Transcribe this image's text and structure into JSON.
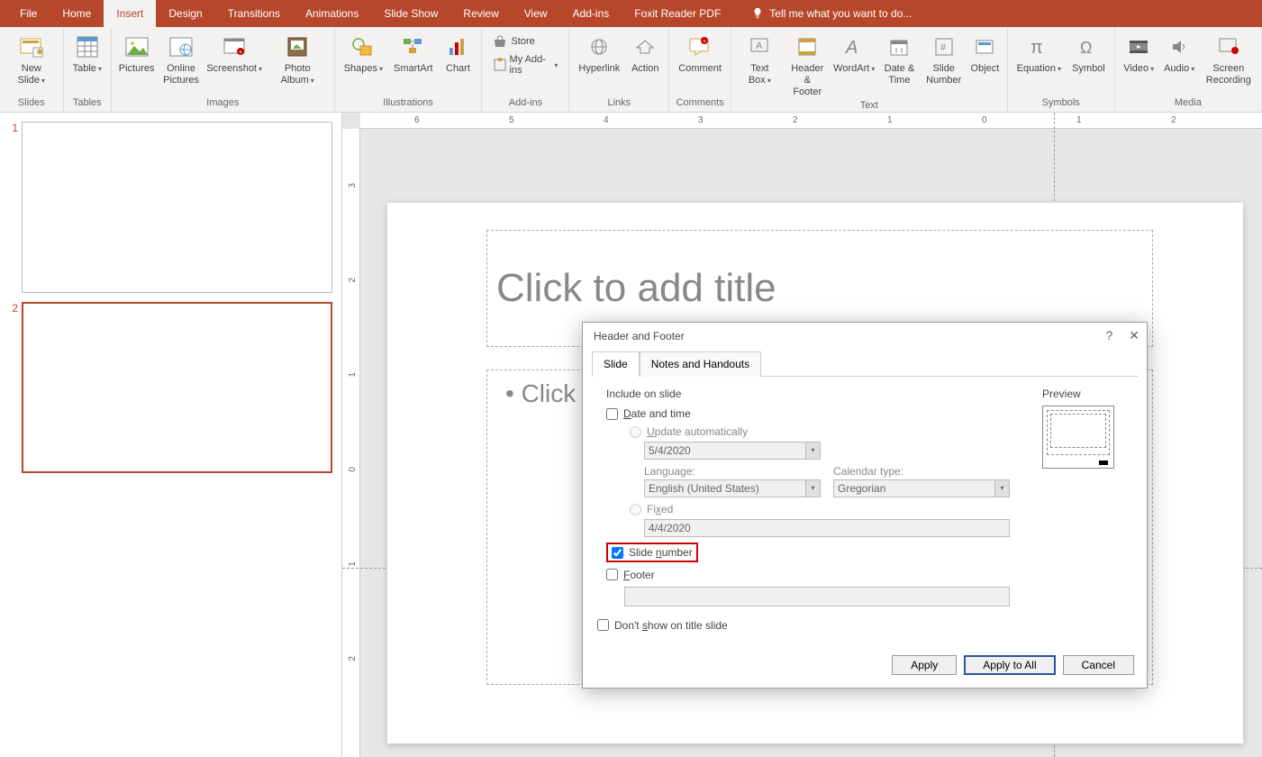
{
  "tabs": {
    "file": "File",
    "home": "Home",
    "insert": "Insert",
    "design": "Design",
    "transitions": "Transitions",
    "animations": "Animations",
    "slideshow": "Slide Show",
    "review": "Review",
    "view": "View",
    "addins": "Add-ins",
    "foxit": "Foxit Reader PDF",
    "tellme": "Tell me what you want to do..."
  },
  "ribbon": {
    "newslide": "New Slide",
    "table": "Table",
    "pictures": "Pictures",
    "onlinepics": "Online Pictures",
    "screenshot": "Screenshot",
    "photoalbum": "Photo Album",
    "shapes": "Shapes",
    "smartart": "SmartArt",
    "chart": "Chart",
    "store": "Store",
    "myaddins": "My Add-ins",
    "hyperlink": "Hyperlink",
    "action": "Action",
    "comment": "Comment",
    "textbox": "Text Box",
    "headerfooter": "Header & Footer",
    "wordart": "WordArt",
    "datetime": "Date & Time",
    "slidenumber": "Slide Number",
    "object": "Object",
    "equation": "Equation",
    "symbol": "Symbol",
    "video": "Video",
    "audio": "Audio",
    "screenrec": "Screen Recording",
    "groups": {
      "slides": "Slides",
      "tables": "Tables",
      "images": "Images",
      "illustrations": "Illustrations",
      "addins": "Add-ins",
      "links": "Links",
      "comments": "Comments",
      "text": "Text",
      "symbols": "Symbols",
      "media": "Media"
    }
  },
  "thumbs": {
    "n1": "1",
    "n2": "2"
  },
  "ruler": {
    "r6": "6",
    "r5": "5",
    "r4": "4",
    "r3": "3",
    "r2": "2",
    "r1": "1",
    "r0": "0"
  },
  "slide": {
    "title_placeholder": "Click to add title",
    "content_placeholder": "• Click"
  },
  "dialog": {
    "title": "Header and Footer",
    "tab_slide": "Slide",
    "tab_notes": "Notes and Handouts",
    "include": "Include on slide",
    "datetime": "Date and time",
    "update_auto": "Update automatically",
    "date_value": "5/4/2020",
    "language_label": "Language:",
    "language_value": "English (United States)",
    "caltype_label": "Calendar type:",
    "caltype_value": "Gregorian",
    "fixed": "Fixed",
    "fixed_value": "4/4/2020",
    "slidenum": "Slide number",
    "footer": "Footer",
    "dontshow": "Don't show on title slide",
    "preview": "Preview",
    "apply": "Apply",
    "applyall": "Apply to All",
    "cancel": "Cancel"
  }
}
